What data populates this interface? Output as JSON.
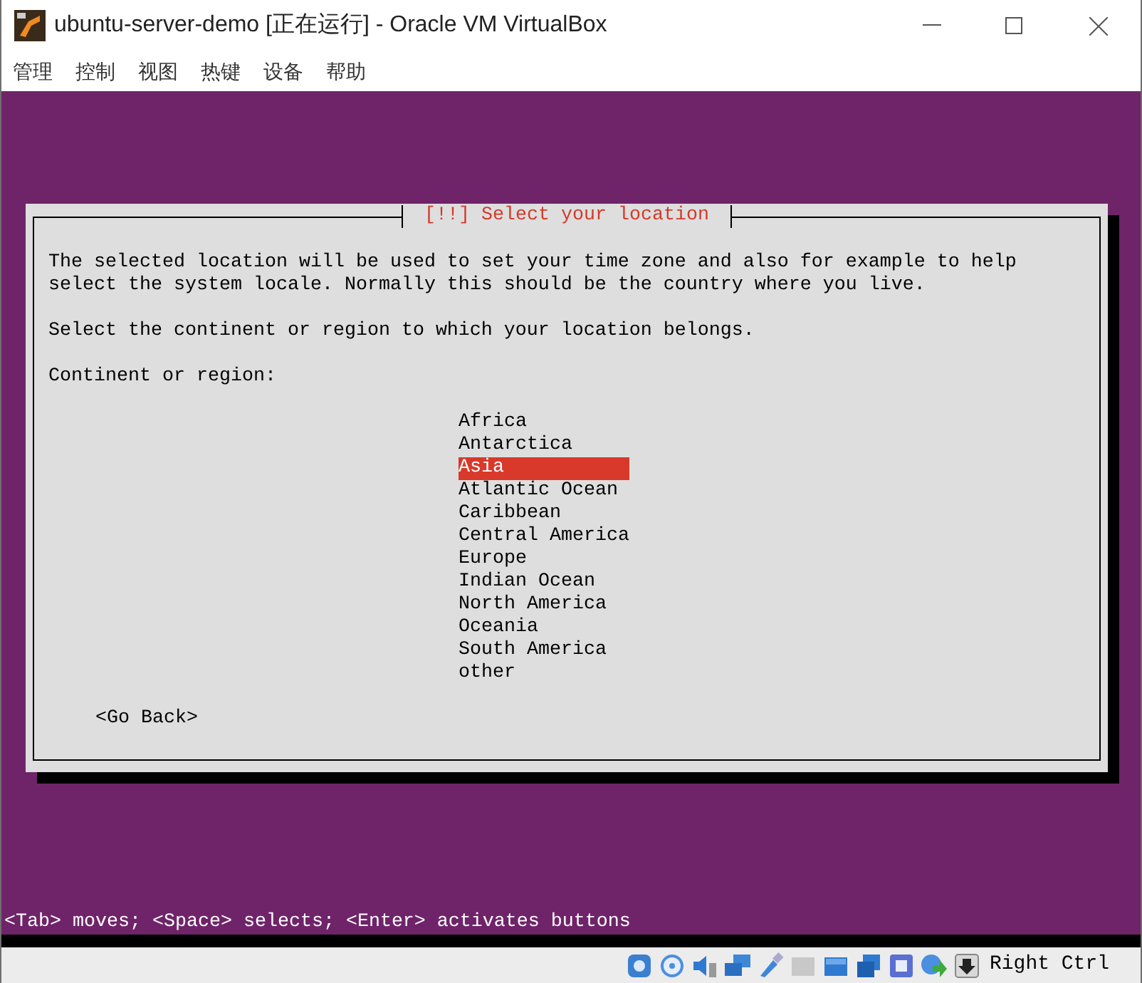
{
  "window": {
    "title": "ubuntu-server-demo [正在运行] - Oracle VM VirtualBox"
  },
  "menu": [
    "管理",
    "控制",
    "视图",
    "热键",
    "设备",
    "帮助"
  ],
  "dialog": {
    "title": "[!!] Select your location",
    "description": "The selected location will be used to set your time zone and also for example to help\nselect the system locale. Normally this should be the country where you live.",
    "instruction": "Select the continent or region to which your location belongs.",
    "prompt": "Continent or region:",
    "options": [
      {
        "label": "Africa",
        "selected": false
      },
      {
        "label": "Antarctica",
        "selected": false
      },
      {
        "label": "Asia",
        "selected": true
      },
      {
        "label": "Atlantic Ocean",
        "selected": false
      },
      {
        "label": "Caribbean",
        "selected": false
      },
      {
        "label": "Central America",
        "selected": false
      },
      {
        "label": "Europe",
        "selected": false
      },
      {
        "label": "Indian Ocean",
        "selected": false
      },
      {
        "label": "North America",
        "selected": false
      },
      {
        "label": "Oceania",
        "selected": false
      },
      {
        "label": "South America",
        "selected": false
      },
      {
        "label": "other",
        "selected": false
      }
    ],
    "back_button": "<Go Back>"
  },
  "hint": "<Tab> moves; <Space> selects; <Enter> activates buttons",
  "status_bar": {
    "host_key": "Right Ctrl"
  }
}
